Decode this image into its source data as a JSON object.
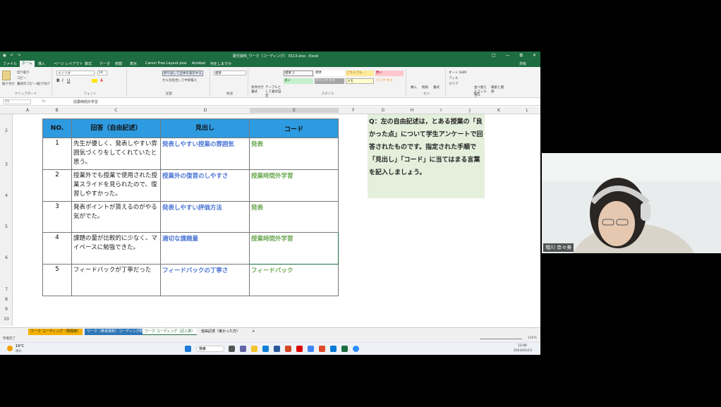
{
  "app": {
    "title": "配付資料_ワーク（コーディング） 0113.xlsx - Excel",
    "quick_access": [
      "保存",
      "元に戻す",
      "やり直し"
    ],
    "window_controls": [
      "□",
      "—",
      "⧉",
      "✕"
    ]
  },
  "ribbon_tabs": [
    "ファイル",
    "ホーム",
    "挿入",
    "ページ レイアウト",
    "数式",
    "データ",
    "校閲",
    "表示",
    "Canon Free Layout plus",
    "Acrobat",
    "何をしますか"
  ],
  "ribbon_share": "共有",
  "ribbon_groups": {
    "clipboard": "クリップボード",
    "font": "フォント",
    "alignment": "配置",
    "number": "数値",
    "styles": "スタイル",
    "cells": "セル",
    "editing": "編集"
  },
  "ribbon_controls": {
    "paste": "貼り付け",
    "cut": "切り取り",
    "copy": "コピー",
    "format_painter": "書式のコピー/貼り付け",
    "font_name": "メイリオ",
    "font_size": "14",
    "wrap": "折り返して全体を表示する",
    "merge": "セルを結合して中央揃え",
    "number_format": "標準",
    "cond_format": "条件付き書式",
    "table_format": "テーブルとして書式設定",
    "cell_styles": "セルのスタイル",
    "style_labels": [
      "標準 2",
      "標準",
      "どちらでも...",
      "悪い",
      "良い",
      "チェック セル",
      "メモ",
      "リンク セル"
    ],
    "insert": "挿入",
    "delete": "削除",
    "format": "書式",
    "autosum": "オート SUM",
    "fill": "フィル",
    "clear": "クリア",
    "sort_filter": "並べ替えとフィルター",
    "find_select": "検索と選択"
  },
  "formula_bar": {
    "name_box": "C5",
    "fx": "fx",
    "value": "授業時間外学習"
  },
  "columns": [
    "A",
    "B",
    "C",
    "D",
    "E",
    "F",
    "G",
    "H",
    "I",
    "J",
    "K",
    "L"
  ],
  "rows": [
    "2",
    "3",
    "4",
    "5",
    "6",
    "7",
    "8",
    "9",
    "10"
  ],
  "table": {
    "headers": [
      "NO.",
      "回答（自由記述）",
      "見出し",
      "コード"
    ],
    "rows": [
      {
        "no": "1",
        "answer": "先生が優しく、発表しやすい雰囲気づくりをしてくれていたと思う。",
        "heading": "発表しやすい授業の雰囲気",
        "code": "発表"
      },
      {
        "no": "2",
        "answer": "授業外でも授業で使用された授業スライドを見られたので、復習しやすかった。",
        "heading": "授業外の復習のしやすさ",
        "code": "授業時間外学習"
      },
      {
        "no": "3",
        "answer": "発表ポイントが貰えるのがやる気がでた。",
        "heading": "発表しやすい評価方法",
        "code": "発表"
      },
      {
        "no": "4",
        "answer": "課題の量が比較的に少なく、マイペースに勉強できた。",
        "heading": "適切な課題量",
        "code": "授業時間外学習"
      },
      {
        "no": "5",
        "answer": "フィードバックが丁寧だった",
        "heading": "フィードバックの丁寧さ",
        "code": "フィードバック"
      }
    ]
  },
  "question_box": "Q：左の自由記述は，とある授業の「良かった点」について学生アンケートで回答されたものです。指定された手順で「見出し」「コード」に当てはまる言葉を記入しましょう。",
  "sheet_tabs": [
    "ワーク コーディング（例題用）",
    "ワーク（参考資料）コーディング例",
    "ワーク コーディング（記入表）",
    "自由記述（良かった方）",
    "+"
  ],
  "status": {
    "ready": "準備完了",
    "zoom": "145%"
  },
  "taskbar": {
    "weather_temp": "19°C",
    "weather_desc": "晴れ",
    "search": "検索",
    "time": "12:06",
    "date": "2023/01/13"
  },
  "participant": {
    "name": "増川 奈々美"
  },
  "colors": {
    "excel_green": "#1e6c41",
    "header_blue": "#2e9ae0",
    "heading_text": "#4a74d4",
    "code_text": "#6aa84f",
    "question_bg": "#e4efdc"
  }
}
